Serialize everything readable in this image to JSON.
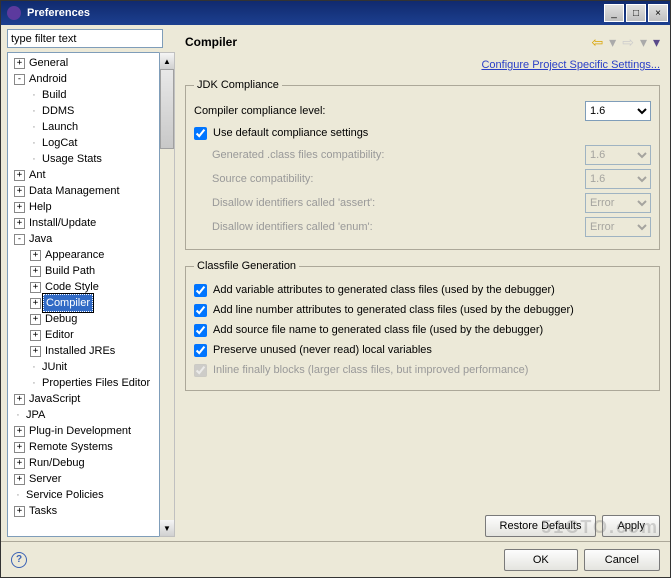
{
  "window": {
    "title": "Preferences"
  },
  "filter_placeholder": "type filter text",
  "tree": [
    {
      "d": 0,
      "exp": "+",
      "label": "General"
    },
    {
      "d": 0,
      "exp": "-",
      "label": "Android"
    },
    {
      "d": 1,
      "exp": "",
      "label": "Build"
    },
    {
      "d": 1,
      "exp": "",
      "label": "DDMS"
    },
    {
      "d": 1,
      "exp": "",
      "label": "Launch"
    },
    {
      "d": 1,
      "exp": "",
      "label": "LogCat"
    },
    {
      "d": 1,
      "exp": "",
      "label": "Usage Stats"
    },
    {
      "d": 0,
      "exp": "+",
      "label": "Ant"
    },
    {
      "d": 0,
      "exp": "+",
      "label": "Data Management"
    },
    {
      "d": 0,
      "exp": "+",
      "label": "Help"
    },
    {
      "d": 0,
      "exp": "+",
      "label": "Install/Update"
    },
    {
      "d": 0,
      "exp": "-",
      "label": "Java"
    },
    {
      "d": 1,
      "exp": "+",
      "label": "Appearance"
    },
    {
      "d": 1,
      "exp": "+",
      "label": "Build Path"
    },
    {
      "d": 1,
      "exp": "+",
      "label": "Code Style"
    },
    {
      "d": 1,
      "exp": "+",
      "label": "Compiler",
      "sel": true
    },
    {
      "d": 1,
      "exp": "+",
      "label": "Debug"
    },
    {
      "d": 1,
      "exp": "+",
      "label": "Editor"
    },
    {
      "d": 1,
      "exp": "+",
      "label": "Installed JREs"
    },
    {
      "d": 1,
      "exp": "",
      "label": "JUnit"
    },
    {
      "d": 1,
      "exp": "",
      "label": "Properties Files Editor"
    },
    {
      "d": 0,
      "exp": "+",
      "label": "JavaScript"
    },
    {
      "d": 0,
      "exp": "",
      "label": "JPA"
    },
    {
      "d": 0,
      "exp": "+",
      "label": "Plug-in Development"
    },
    {
      "d": 0,
      "exp": "+",
      "label": "Remote Systems"
    },
    {
      "d": 0,
      "exp": "+",
      "label": "Run/Debug"
    },
    {
      "d": 0,
      "exp": "+",
      "label": "Server"
    },
    {
      "d": 0,
      "exp": "",
      "label": "Service Policies"
    },
    {
      "d": 0,
      "exp": "+",
      "label": "Tasks"
    }
  ],
  "page": {
    "title": "Compiler",
    "config_link": "Configure Project Specific Settings..."
  },
  "jdk": {
    "legend": "JDK Compliance",
    "level_label": "Compiler compliance level:",
    "level_value": "1.6",
    "use_default": "Use default compliance settings",
    "gen_class": "Generated .class files compatibility:",
    "gen_class_val": "1.6",
    "source": "Source compatibility:",
    "source_val": "1.6",
    "assert": "Disallow identifiers called 'assert':",
    "assert_val": "Error",
    "enum": "Disallow identifiers called 'enum':",
    "enum_val": "Error"
  },
  "cf": {
    "legend": "Classfile Generation",
    "c1": "Add variable attributes to generated class files (used by the debugger)",
    "c2": "Add line number attributes to generated class files (used by the debugger)",
    "c3": "Add source file name to generated class file (used by the debugger)",
    "c4": "Preserve unused (never read) local variables",
    "c5": "Inline finally blocks (larger class files, but improved performance)"
  },
  "buttons": {
    "restore": "Restore Defaults",
    "apply": "Apply",
    "ok": "OK",
    "cancel": "Cancel"
  },
  "watermark": "51CTO.com"
}
